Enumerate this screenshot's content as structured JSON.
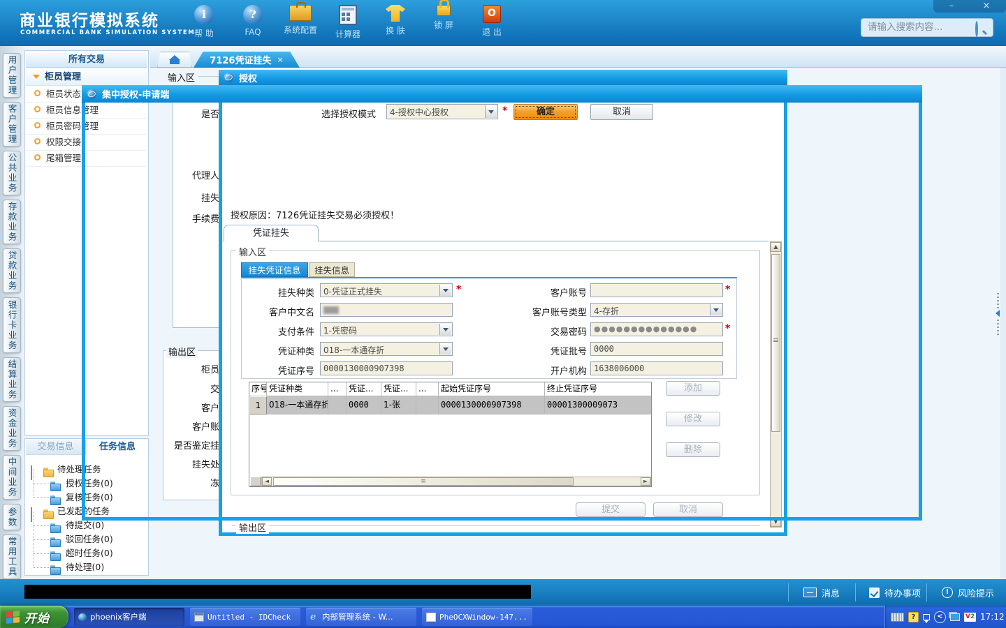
{
  "app": {
    "title": "商业银行模拟系统",
    "subtitle": "COMMERCIAL BANK SIMULATION SYSTEM"
  },
  "header": {
    "toolbar": [
      "帮 助",
      "FAQ",
      "系统配置",
      "计算器",
      "换 肤",
      "锁 屏",
      "退 出"
    ],
    "search_placeholder": "请输入搜索内容...",
    "minimize": "–",
    "close": "×"
  },
  "sidebar_tabs": [
    "用户管理",
    "客户管理",
    "公共业务",
    "存款业务",
    "贷款业务",
    "银行卡业务",
    "结算业务",
    "资金业务",
    "中间业务",
    "参数",
    "常用工具"
  ],
  "nav_panel": {
    "header": "所有交易",
    "group": "柜员管理",
    "items": [
      "柜员状态管理",
      "柜员信息管理",
      "柜员密码管理",
      "权限交接",
      "尾箱管理"
    ]
  },
  "task_panel": {
    "tabs": [
      "交易信息",
      "任务信息"
    ],
    "tree": [
      {
        "label": "待处理任务",
        "children": [
          "授权任务(0)",
          "复核任务(0)"
        ]
      },
      {
        "label": "已发起的任务",
        "children": [
          "待提交(0)",
          "驳回任务(0)",
          "超时任务(0)",
          "待处理(0)"
        ]
      }
    ]
  },
  "tabbar": {
    "tab": "7126凭证挂失",
    "close": "×"
  },
  "bg_page": {
    "input_group": "输入区",
    "left_labels": [
      "是否",
      "代理人",
      "挂失",
      "手续费"
    ],
    "output_group": "输出区",
    "output_labels": [
      "柜员",
      "交",
      "客户",
      "客户账",
      "是否鉴定挂",
      "挂失处",
      "冻"
    ]
  },
  "outer_window": {
    "title": "集中授权-申请端"
  },
  "auth_window": {
    "title": "授权",
    "mode_label": "选择授权模式",
    "mode_value": "4-授权中心授权",
    "required": "*",
    "ok": "确定",
    "cancel": "取消",
    "reason": "授权原因：7126凭证挂失交易必须授权！",
    "page_tab": "凭证挂失",
    "input_group": "输入区",
    "output_group": "输出区",
    "form_tabs": [
      "挂失凭证信息",
      "挂失信息"
    ],
    "fields": {
      "loss_type_label": "挂失种类",
      "loss_type_value": "0-凭证正式挂失",
      "account_label": "客户账号",
      "account_value": "",
      "cust_name_label": "客户中文名",
      "account_type_label": "客户账号类型",
      "account_type_value": "4-存折",
      "pay_cond_label": "支付条件",
      "pay_cond_value": "1-凭密码",
      "password_label": "交易密码",
      "password_dots": "●●●●●●●●●●●●●●",
      "voucher_type_label": "凭证种类",
      "voucher_type_value": "018-一本通存折",
      "batch_label": "凭证批号",
      "batch_value": "0000",
      "serial_label": "凭证序号",
      "serial_value": "0000130000907398",
      "branch_label": "开户机构",
      "branch_value": "1638006000"
    },
    "table": {
      "headers": [
        "序号",
        "凭证种类",
        "...",
        "凭证...",
        "凭证...",
        "...",
        "起始凭证序号",
        "终止凭证序号"
      ],
      "row": [
        "1",
        "018-一本通存折",
        "",
        "0000",
        "1-张",
        "",
        "0000130000907398",
        "00001300009073"
      ]
    },
    "buttons": {
      "add": "添加",
      "modify": "修改",
      "delete": "删除",
      "submit": "提交",
      "cancel": "取消"
    }
  },
  "status_bar": {
    "message": "消息",
    "todo": "待办事项",
    "risk": "风险提示"
  },
  "taskbar": {
    "start": "开始",
    "tasks": [
      "phoenix客户端",
      "Untitled - IDCheck",
      "内部管理系统 - W...",
      "PheOCXWindow-147..."
    ],
    "time": "17:12"
  },
  "icons": {
    "up": "▲",
    "down": "▼",
    "left": "◄",
    "right": "►",
    "grip": "≡",
    "lang": "<",
    "tray_help": "?",
    "exit": "O",
    "help": "i",
    "faq": "?"
  }
}
